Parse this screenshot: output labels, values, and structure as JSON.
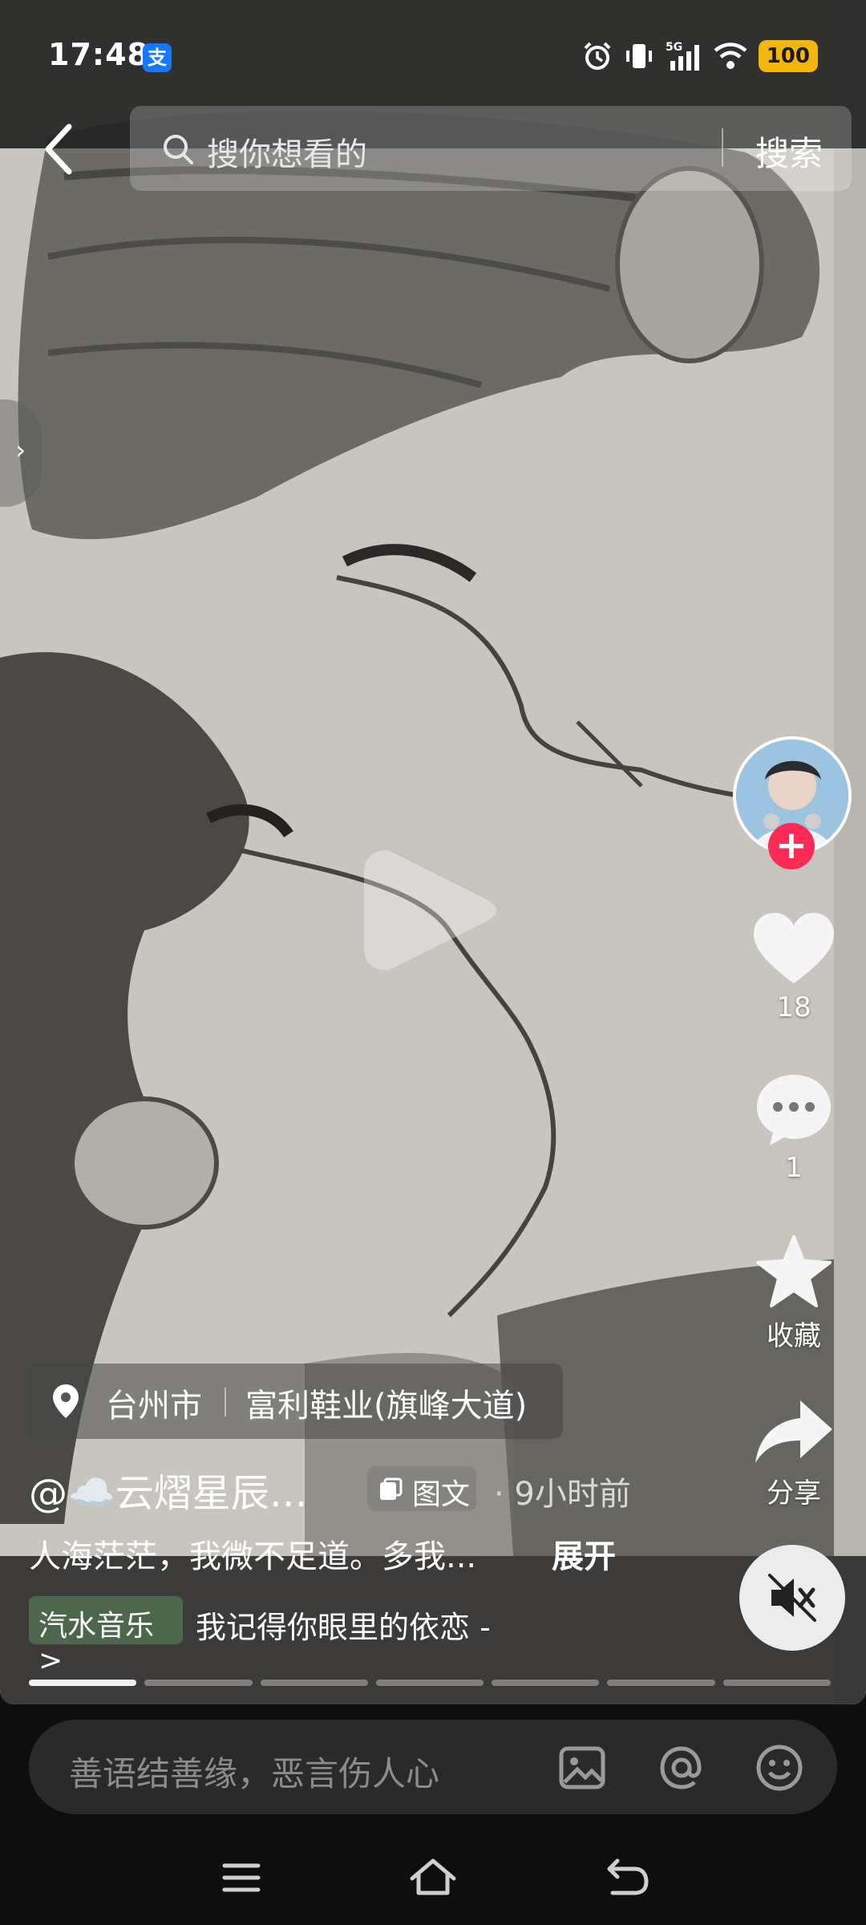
{
  "status_bar": {
    "time": "17:48",
    "alipay_badge": "支",
    "network": "5G",
    "battery": "100"
  },
  "header": {
    "search_placeholder": "搜你想看的",
    "search_button": "搜索"
  },
  "post": {
    "location_city": "台州市",
    "location_place": "富利鞋业(旗峰大道)",
    "author": "@☁️云熠星辰…",
    "type_tag": "图文",
    "time_ago": "· 9小时前",
    "description": "人海茫茫，我微不足道。多我...",
    "expand_label": "展开",
    "music_source": "汽水音乐 >",
    "music_title": "我记得你眼里的依恋 -",
    "image_count": 7,
    "current_image": 1
  },
  "actions": {
    "likes": "18",
    "comments": "1",
    "favorite_label": "收藏",
    "share_label": "分享"
  },
  "comment_bar": {
    "placeholder": "善语结善缘，恶言伤人心"
  },
  "colors": {
    "follow": "#fe2c55",
    "battery": "#f3b60d",
    "alipay": "#1677ff"
  }
}
